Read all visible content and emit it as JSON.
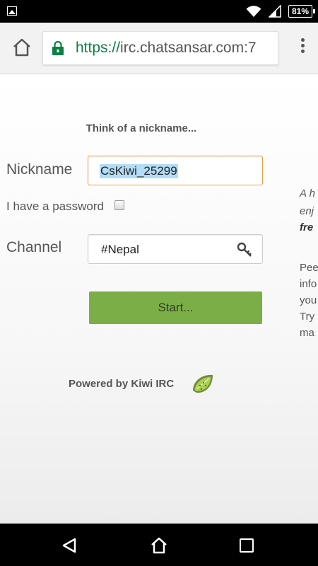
{
  "status_bar": {
    "battery": "81%"
  },
  "browser": {
    "url_scheme": "https://",
    "url_host": "irc.chatsansar.com:7"
  },
  "page": {
    "heading": "Think of a nickname...",
    "nickname_label": "Nickname",
    "nickname_value": "CsKiwi_25299",
    "password_label": "I have a password",
    "channel_label": "Channel",
    "channel_value": "#Nepal",
    "start_label": "Start...",
    "powered_by": "Powered by Kiwi IRC"
  },
  "side_text": {
    "line1": "A h",
    "line2": "enj",
    "line3": "fre",
    "line4": "Pee",
    "line5": "info",
    "line6": "you",
    "line7": "Try",
    "line8": "ma"
  },
  "colors": {
    "accent_green": "#7cae48",
    "focus_orange": "#e2a24d",
    "selection_blue": "#b3dcf5",
    "secure_green": "#0b8043"
  },
  "icons": {
    "home": "home-icon",
    "lock": "lock-icon",
    "menu": "more-vert-icon",
    "key": "key-icon",
    "logo": "kiwi-logo-icon"
  }
}
